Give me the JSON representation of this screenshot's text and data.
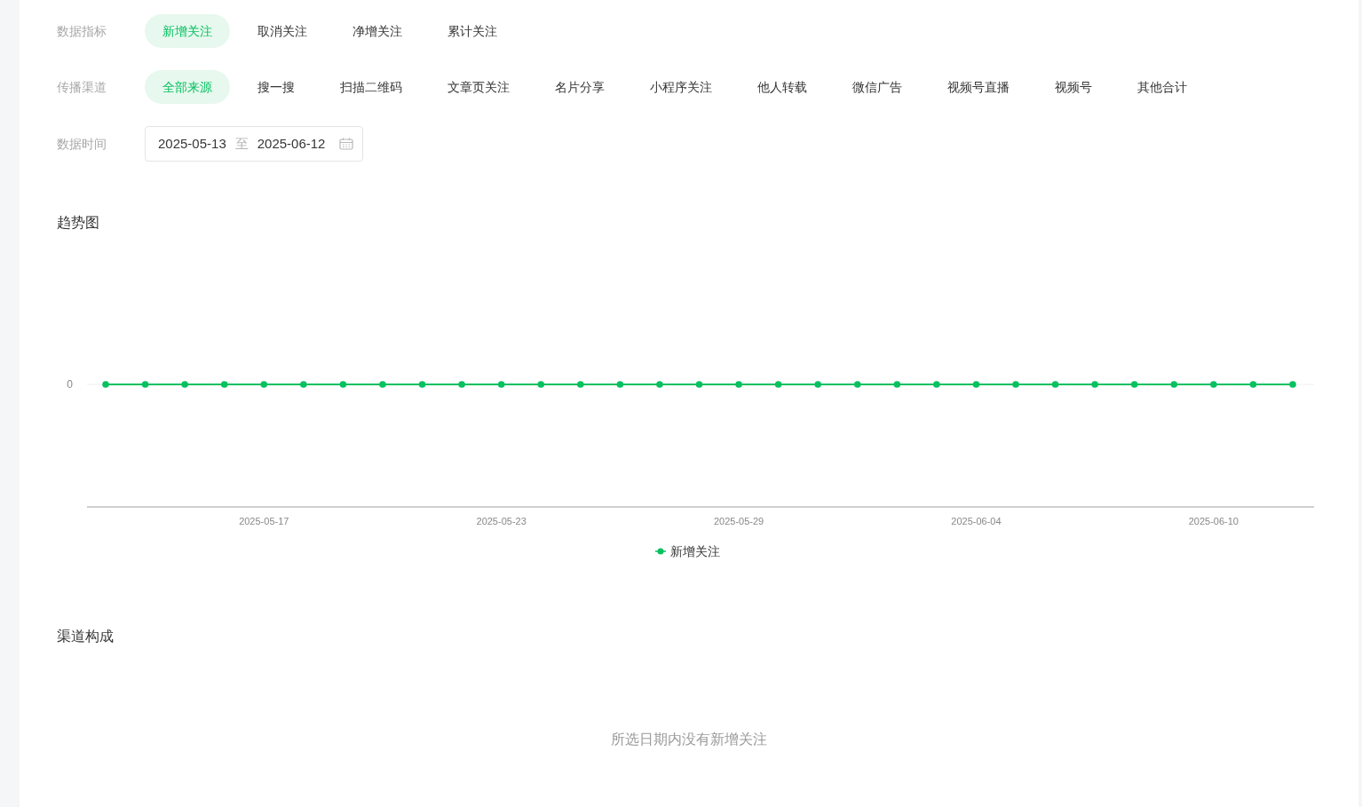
{
  "filters": [
    {
      "label": "数据指标",
      "options": [
        {
          "label": "新增关注",
          "selected": true
        },
        {
          "label": "取消关注",
          "selected": false
        },
        {
          "label": "净增关注",
          "selected": false
        },
        {
          "label": "累计关注",
          "selected": false
        }
      ]
    },
    {
      "label": "传播渠道",
      "options": [
        {
          "label": "全部来源",
          "selected": true
        },
        {
          "label": "搜一搜",
          "selected": false
        },
        {
          "label": "扫描二维码",
          "selected": false
        },
        {
          "label": "文章页关注",
          "selected": false
        },
        {
          "label": "名片分享",
          "selected": false
        },
        {
          "label": "小程序关注",
          "selected": false
        },
        {
          "label": "他人转载",
          "selected": false
        },
        {
          "label": "微信广告",
          "selected": false
        },
        {
          "label": "视频号直播",
          "selected": false
        },
        {
          "label": "视频号",
          "selected": false
        },
        {
          "label": "其他合计",
          "selected": false
        }
      ]
    }
  ],
  "date_range": {
    "label": "数据时间",
    "start": "2025-05-13",
    "separator": "至",
    "end": "2025-06-12"
  },
  "trend": {
    "title": "趋势图",
    "y_axis_labels": [
      "0"
    ],
    "x_axis_labels": [
      "2025-05-17",
      "2025-05-23",
      "2025-05-29",
      "2025-06-04",
      "2025-06-10"
    ],
    "legend": [
      {
        "name": "新增关注",
        "color": "#07c160"
      }
    ]
  },
  "composition": {
    "title": "渠道构成",
    "empty_message": "所选日期内没有新增关注"
  }
}
